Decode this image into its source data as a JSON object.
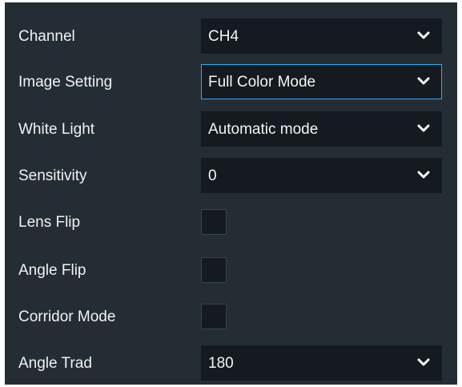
{
  "fields": {
    "channel": {
      "label": "Channel",
      "value": "CH4"
    },
    "image_setting": {
      "label": "Image Setting",
      "value": "Full Color Mode"
    },
    "white_light": {
      "label": "White Light",
      "value": "Automatic mode"
    },
    "sensitivity": {
      "label": "Sensitivity",
      "value": "0"
    },
    "lens_flip": {
      "label": "Lens Flip",
      "checked": false
    },
    "angle_flip": {
      "label": "Angle Flip",
      "checked": false
    },
    "corridor_mode": {
      "label": "Corridor Mode",
      "checked": false
    },
    "angle_trad": {
      "label": "Angle Trad",
      "value": "180"
    }
  },
  "icons": {
    "dropdown": "chevron-down-icon"
  },
  "colors": {
    "panel_bg": "#252d34",
    "control_bg": "#141a1f",
    "focus_border": "#35a9f5",
    "text": "#f2f2f2"
  }
}
